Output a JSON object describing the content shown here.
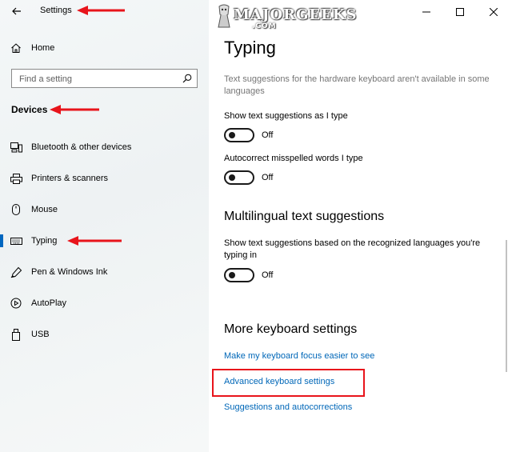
{
  "window": {
    "title": "Settings",
    "controls": [
      "minimize-icon",
      "maximize-icon",
      "close-icon"
    ]
  },
  "watermark": {
    "main": "MAJORGEEKS",
    "sub": ".COM"
  },
  "sidebar": {
    "home_label": "Home",
    "search_placeholder": "Find a setting",
    "section_label": "Devices",
    "items": [
      {
        "label": "Bluetooth & other devices",
        "icon": "bluetooth-devices-icon"
      },
      {
        "label": "Printers & scanners",
        "icon": "printer-icon"
      },
      {
        "label": "Mouse",
        "icon": "mouse-icon"
      },
      {
        "label": "Typing",
        "icon": "keyboard-icon",
        "selected": true
      },
      {
        "label": "Pen & Windows Ink",
        "icon": "pen-icon"
      },
      {
        "label": "AutoPlay",
        "icon": "autoplay-icon"
      },
      {
        "label": "USB",
        "icon": "usb-icon"
      }
    ]
  },
  "main": {
    "page_title": "Typing",
    "hardware_note": "Text suggestions for the hardware keyboard aren't available in some languages",
    "show_suggestions_label": "Show text suggestions as I type",
    "show_suggestions_state": "Off",
    "autocorrect_label": "Autocorrect misspelled words I type",
    "autocorrect_state": "Off",
    "multilingual_title": "Multilingual text suggestions",
    "multilingual_label": "Show text suggestions based on the recognized languages you're typing in",
    "multilingual_state": "Off",
    "more_title": "More keyboard settings",
    "links": [
      "Make my keyboard focus easier to see",
      "Advanced keyboard settings",
      "Suggestions and autocorrections"
    ]
  },
  "colors": {
    "annotation_red": "#e8141b",
    "link_blue": "#0067b8",
    "accent": "#0067c0"
  }
}
